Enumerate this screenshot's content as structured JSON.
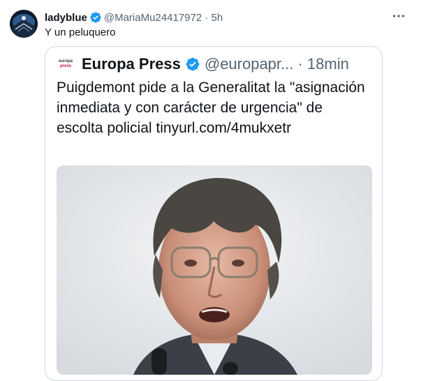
{
  "tweet": {
    "author_name": "ladyblue",
    "author_handle": "@MariaMu24417972 · 5h",
    "text": "Y un peluquero"
  },
  "quoted": {
    "logo_line1": "europa",
    "logo_line2": "press",
    "author_name": "Europa Press",
    "author_handle": "@europapr... · 18min",
    "text": "Puigdemont pide a la Generalitat la \"asignación inmediata y con carácter de urgencia\" de escolta policial tinyurl.com/4mukxetr"
  },
  "colors": {
    "verified": "#1d9bf0",
    "secondary_text": "#536471",
    "border": "#cfd9de"
  },
  "icons": {
    "more": "more-options-icon",
    "verified": "verified-badge-icon"
  }
}
